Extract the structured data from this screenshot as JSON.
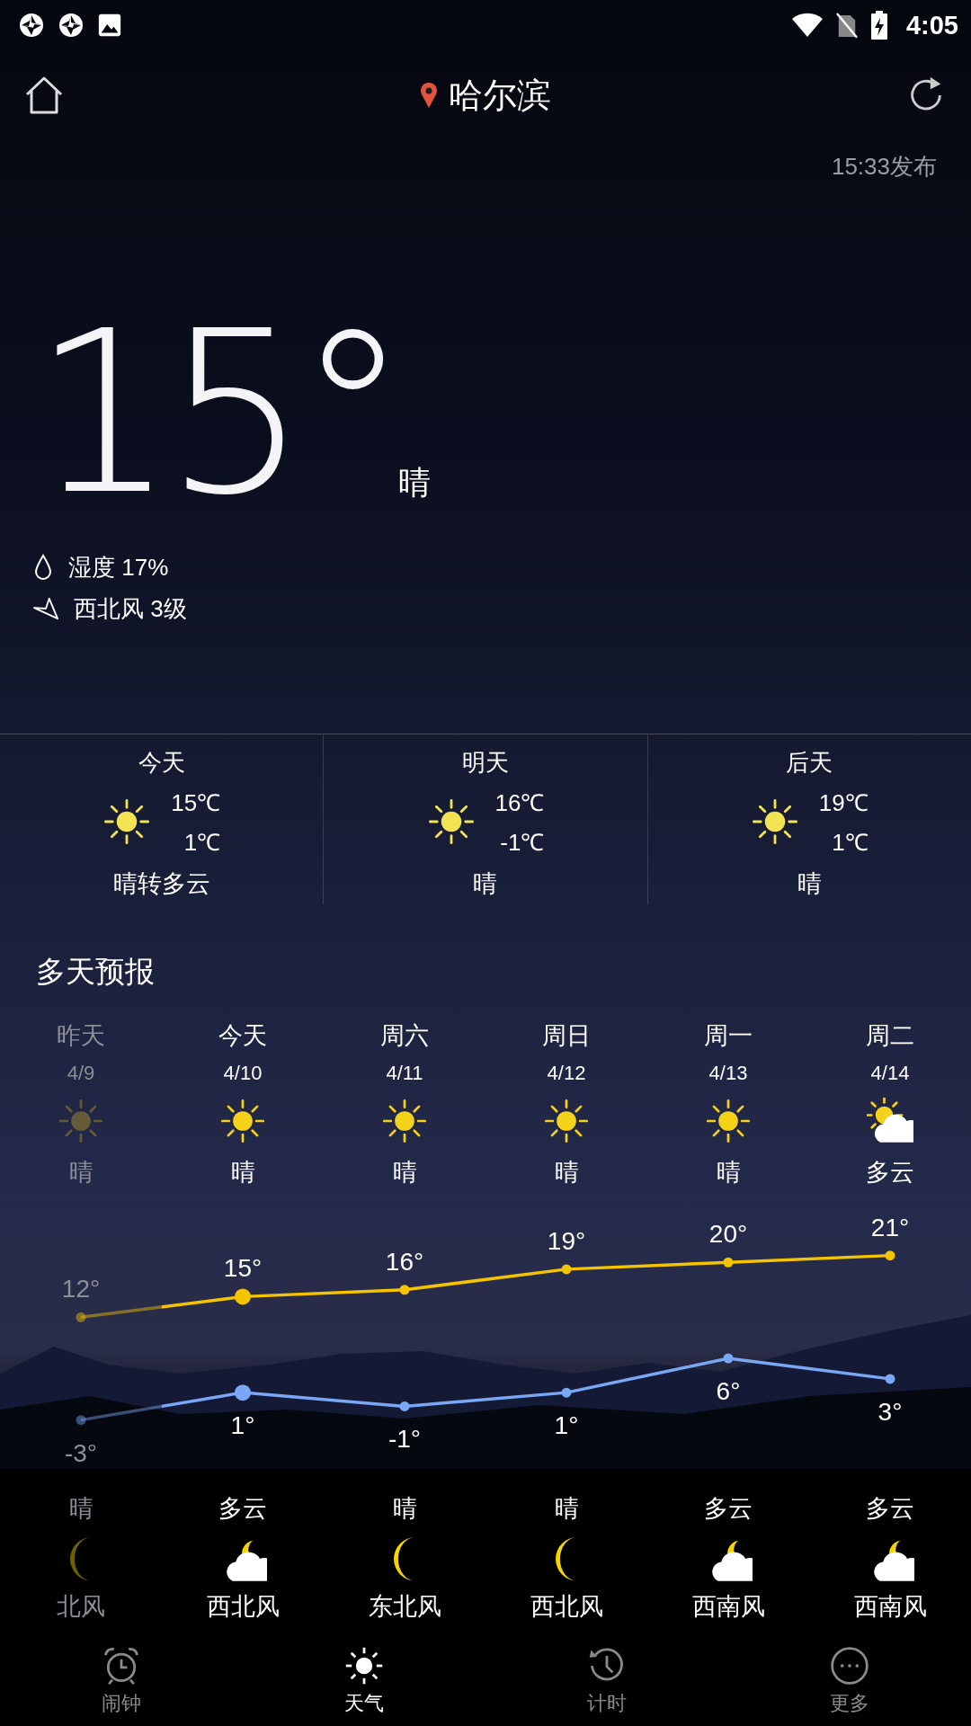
{
  "status_bar": {
    "time": "4:05"
  },
  "header": {
    "city": "哈尔滨",
    "published": "15:33发布"
  },
  "current": {
    "temperature": "15°",
    "condition": "晴",
    "humidity": "湿度 17%",
    "wind": "西北风 3级"
  },
  "three_day": [
    {
      "day": "今天",
      "kind": "sunny",
      "high": "15℃",
      "low": "1℃",
      "condition": "晴转多云"
    },
    {
      "day": "明天",
      "kind": "sunny",
      "high": "16℃",
      "low": "-1℃",
      "condition": "晴"
    },
    {
      "day": "后天",
      "kind": "sunny",
      "high": "19℃",
      "low": "1℃",
      "condition": "晴"
    }
  ],
  "forecast": {
    "title": "多天预报",
    "days": [
      {
        "day": "昨天",
        "date": "4/9",
        "kind": "sunny",
        "condition": "晴",
        "night": {
          "condition": "晴",
          "kind": "clear_night"
        },
        "wind": "北风",
        "past": true
      },
      {
        "day": "今天",
        "date": "4/10",
        "kind": "sunny",
        "condition": "晴",
        "night": {
          "condition": "多云",
          "kind": "cloudy_night"
        },
        "wind": "西北风",
        "past": false
      },
      {
        "day": "周六",
        "date": "4/11",
        "kind": "sunny",
        "condition": "晴",
        "night": {
          "condition": "晴",
          "kind": "clear_night"
        },
        "wind": "东北风",
        "past": false
      },
      {
        "day": "周日",
        "date": "4/12",
        "kind": "sunny",
        "condition": "晴",
        "night": {
          "condition": "晴",
          "kind": "clear_night"
        },
        "wind": "西北风",
        "past": false
      },
      {
        "day": "周一",
        "date": "4/13",
        "kind": "sunny",
        "condition": "晴",
        "night": {
          "condition": "多云",
          "kind": "cloudy_night"
        },
        "wind": "西南风",
        "past": false
      },
      {
        "day": "周二",
        "date": "4/14",
        "kind": "partly_cloudy",
        "condition": "多云",
        "night": {
          "condition": "多云",
          "kind": "cloudy_night"
        },
        "wind": "西南风",
        "past": false
      }
    ],
    "chart_data": {
      "type": "line",
      "series": [
        {
          "color": "#f5c400",
          "line_style": "solid",
          "marker": "circle",
          "values": [
            12,
            15,
            16,
            19,
            20,
            21
          ],
          "value_labels": [
            "12°",
            "15°",
            "16°",
            "19°",
            "20°",
            "21°"
          ]
        },
        {
          "color": "#7aa7f5",
          "line_style": "solid",
          "marker": "circle",
          "values": [
            -3,
            1,
            -1,
            1,
            6,
            3
          ],
          "value_labels": [
            "-3°",
            "1°",
            "-1°",
            "1°",
            "6°",
            "3°"
          ]
        }
      ]
    }
  },
  "nav": [
    {
      "label": "闹钟",
      "kind": "alarm",
      "selected": false
    },
    {
      "label": "天气",
      "kind": "sun",
      "selected": true
    },
    {
      "label": "计时",
      "kind": "timer",
      "selected": false
    },
    {
      "label": "更多",
      "kind": "more",
      "selected": false
    }
  ]
}
